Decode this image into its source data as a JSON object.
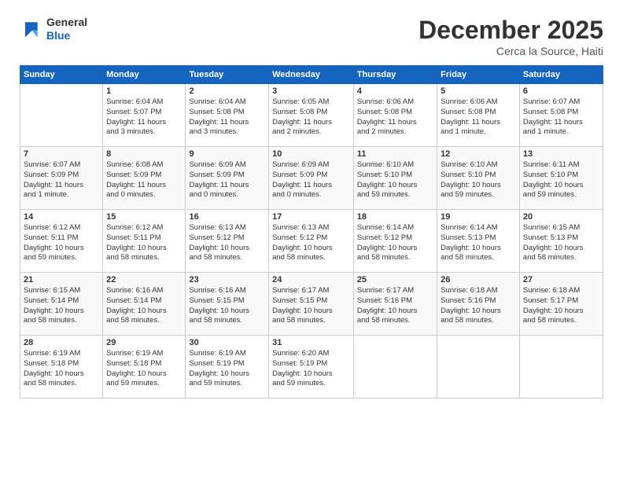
{
  "header": {
    "logo_general": "General",
    "logo_blue": "Blue",
    "month_title": "December 2025",
    "subtitle": "Cerca la Source, Haiti"
  },
  "days_of_week": [
    "Sunday",
    "Monday",
    "Tuesday",
    "Wednesday",
    "Thursday",
    "Friday",
    "Saturday"
  ],
  "weeks": [
    [
      {
        "day": "",
        "info": ""
      },
      {
        "day": "1",
        "info": "Sunrise: 6:04 AM\nSunset: 5:07 PM\nDaylight: 11 hours\nand 3 minutes."
      },
      {
        "day": "2",
        "info": "Sunrise: 6:04 AM\nSunset: 5:08 PM\nDaylight: 11 hours\nand 3 minutes."
      },
      {
        "day": "3",
        "info": "Sunrise: 6:05 AM\nSunset: 5:08 PM\nDaylight: 11 hours\nand 2 minutes."
      },
      {
        "day": "4",
        "info": "Sunrise: 6:06 AM\nSunset: 5:08 PM\nDaylight: 11 hours\nand 2 minutes."
      },
      {
        "day": "5",
        "info": "Sunrise: 6:06 AM\nSunset: 5:08 PM\nDaylight: 11 hours\nand 1 minute."
      },
      {
        "day": "6",
        "info": "Sunrise: 6:07 AM\nSunset: 5:08 PM\nDaylight: 11 hours\nand 1 minute."
      }
    ],
    [
      {
        "day": "7",
        "info": "Sunrise: 6:07 AM\nSunset: 5:09 PM\nDaylight: 11 hours\nand 1 minute."
      },
      {
        "day": "8",
        "info": "Sunrise: 6:08 AM\nSunset: 5:09 PM\nDaylight: 11 hours\nand 0 minutes."
      },
      {
        "day": "9",
        "info": "Sunrise: 6:09 AM\nSunset: 5:09 PM\nDaylight: 11 hours\nand 0 minutes."
      },
      {
        "day": "10",
        "info": "Sunrise: 6:09 AM\nSunset: 5:09 PM\nDaylight: 11 hours\nand 0 minutes."
      },
      {
        "day": "11",
        "info": "Sunrise: 6:10 AM\nSunset: 5:10 PM\nDaylight: 10 hours\nand 59 minutes."
      },
      {
        "day": "12",
        "info": "Sunrise: 6:10 AM\nSunset: 5:10 PM\nDaylight: 10 hours\nand 59 minutes."
      },
      {
        "day": "13",
        "info": "Sunrise: 6:11 AM\nSunset: 5:10 PM\nDaylight: 10 hours\nand 59 minutes."
      }
    ],
    [
      {
        "day": "14",
        "info": "Sunrise: 6:12 AM\nSunset: 5:11 PM\nDaylight: 10 hours\nand 59 minutes."
      },
      {
        "day": "15",
        "info": "Sunrise: 6:12 AM\nSunset: 5:11 PM\nDaylight: 10 hours\nand 58 minutes."
      },
      {
        "day": "16",
        "info": "Sunrise: 6:13 AM\nSunset: 5:12 PM\nDaylight: 10 hours\nand 58 minutes."
      },
      {
        "day": "17",
        "info": "Sunrise: 6:13 AM\nSunset: 5:12 PM\nDaylight: 10 hours\nand 58 minutes."
      },
      {
        "day": "18",
        "info": "Sunrise: 6:14 AM\nSunset: 5:12 PM\nDaylight: 10 hours\nand 58 minutes."
      },
      {
        "day": "19",
        "info": "Sunrise: 6:14 AM\nSunset: 5:13 PM\nDaylight: 10 hours\nand 58 minutes."
      },
      {
        "day": "20",
        "info": "Sunrise: 6:15 AM\nSunset: 5:13 PM\nDaylight: 10 hours\nand 58 minutes."
      }
    ],
    [
      {
        "day": "21",
        "info": "Sunrise: 6:15 AM\nSunset: 5:14 PM\nDaylight: 10 hours\nand 58 minutes."
      },
      {
        "day": "22",
        "info": "Sunrise: 6:16 AM\nSunset: 5:14 PM\nDaylight: 10 hours\nand 58 minutes."
      },
      {
        "day": "23",
        "info": "Sunrise: 6:16 AM\nSunset: 5:15 PM\nDaylight: 10 hours\nand 58 minutes."
      },
      {
        "day": "24",
        "info": "Sunrise: 6:17 AM\nSunset: 5:15 PM\nDaylight: 10 hours\nand 58 minutes."
      },
      {
        "day": "25",
        "info": "Sunrise: 6:17 AM\nSunset: 5:16 PM\nDaylight: 10 hours\nand 58 minutes."
      },
      {
        "day": "26",
        "info": "Sunrise: 6:18 AM\nSunset: 5:16 PM\nDaylight: 10 hours\nand 58 minutes."
      },
      {
        "day": "27",
        "info": "Sunrise: 6:18 AM\nSunset: 5:17 PM\nDaylight: 10 hours\nand 58 minutes."
      }
    ],
    [
      {
        "day": "28",
        "info": "Sunrise: 6:19 AM\nSunset: 5:18 PM\nDaylight: 10 hours\nand 58 minutes."
      },
      {
        "day": "29",
        "info": "Sunrise: 6:19 AM\nSunset: 5:18 PM\nDaylight: 10 hours\nand 59 minutes."
      },
      {
        "day": "30",
        "info": "Sunrise: 6:19 AM\nSunset: 5:19 PM\nDaylight: 10 hours\nand 59 minutes."
      },
      {
        "day": "31",
        "info": "Sunrise: 6:20 AM\nSunset: 5:19 PM\nDaylight: 10 hours\nand 59 minutes."
      },
      {
        "day": "",
        "info": ""
      },
      {
        "day": "",
        "info": ""
      },
      {
        "day": "",
        "info": ""
      }
    ]
  ]
}
